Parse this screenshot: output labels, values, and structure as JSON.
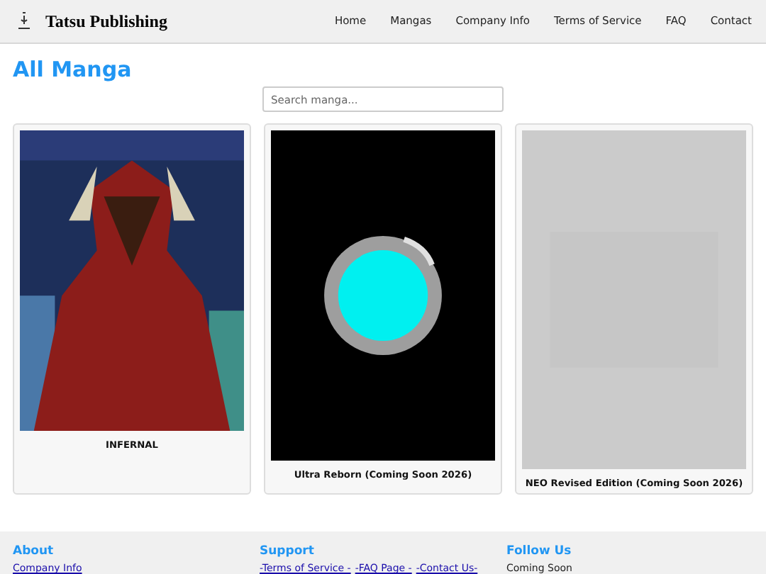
{
  "header": {
    "brand": "Tatsu Publishing",
    "nav": [
      "Home",
      "Mangas",
      "Company Info",
      "Terms of Service",
      "FAQ",
      "Contact"
    ]
  },
  "heading": "All Manga",
  "search": {
    "placeholder": "Search manga..."
  },
  "mangas": [
    {
      "title": "INFERNAL"
    },
    {
      "title": "Ultra Reborn (Coming Soon 2026)"
    },
    {
      "title": "NEO Revised Edition (Coming Soon 2026)"
    }
  ],
  "footer": [
    {
      "heading": "About",
      "links": [
        "Company Info"
      ]
    },
    {
      "heading": "Support",
      "links": [
        "-Terms of Service -",
        "-FAQ Page -",
        "-Contact Us-"
      ]
    },
    {
      "heading": "Follow Us",
      "note": "Coming Soon"
    }
  ]
}
